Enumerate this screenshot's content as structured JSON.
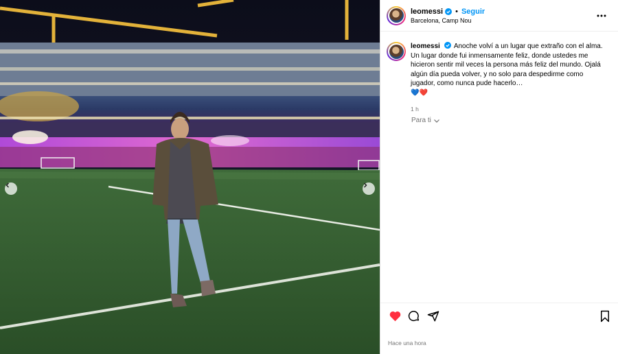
{
  "header": {
    "username": "leomessi",
    "separator": "•",
    "follow_label": "Seguir",
    "location": "Barcelona, Camp Nou"
  },
  "caption": {
    "username": "leomessi",
    "text": "Anoche volví a un lugar que extraño con el alma. Un lugar donde fui inmensamente feliz, donde ustedes me hicieron sentir mil veces la persona más feliz del mundo. Ojalá algún día pueda volver, y no solo para despedirme como jugador, como nunca pude hacerlo…",
    "emojis": "💙❤️",
    "time": "1 h"
  },
  "translate": {
    "label": "Para ti"
  },
  "footer": {
    "posted": "Hace una hora"
  },
  "colors": {
    "follow": "#0095f6",
    "like": "#ff3040",
    "verified": "#0095f6"
  },
  "icons": [
    "verified-badge-icon",
    "more-options-icon",
    "heart-icon",
    "comment-icon",
    "share-icon",
    "bookmark-icon",
    "chevron-left-icon",
    "chevron-right-icon",
    "chevron-down-icon"
  ]
}
